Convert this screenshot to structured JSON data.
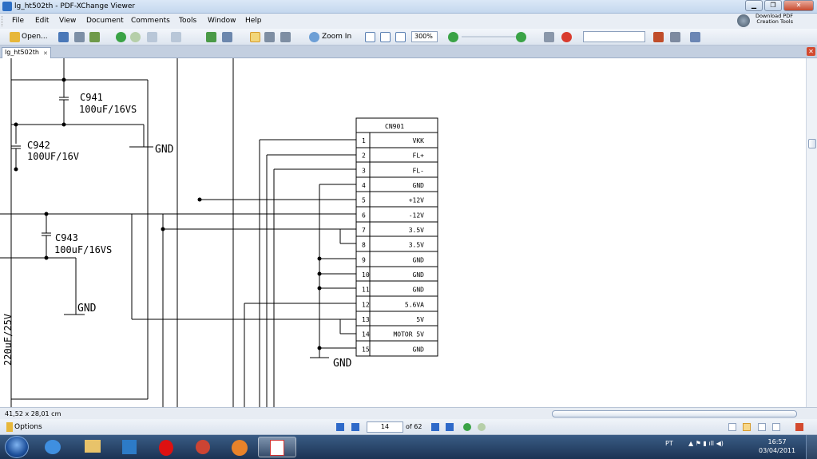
{
  "window": {
    "title": "lg_ht502th - PDF-XChange Viewer"
  },
  "menu": [
    "File",
    "Edit",
    "View",
    "Document",
    "Comments",
    "Tools",
    "Window",
    "Help"
  ],
  "download_promo": {
    "line1": "Download PDF",
    "line2": "Creation Tools"
  },
  "toolbar": {
    "open_label": "Open...",
    "zoom_in_label": "Zoom In",
    "zoom_value": "300%"
  },
  "tab": {
    "label": "lg_ht502th"
  },
  "schematic": {
    "c941": {
      "ref": "C941",
      "value": "100uF/16VS"
    },
    "c942": {
      "ref": "C942",
      "value": "100UF/16V"
    },
    "c943": {
      "ref": "C943",
      "value": "100uF/16VS"
    },
    "vertical_value": "220uF/25V",
    "gnd_label": "GND",
    "connector": {
      "title": "CN901",
      "pins": [
        {
          "num": "1",
          "name": "VKK"
        },
        {
          "num": "2",
          "name": "FL+"
        },
        {
          "num": "3",
          "name": "FL-"
        },
        {
          "num": "4",
          "name": "GND"
        },
        {
          "num": "5",
          "name": "+12V"
        },
        {
          "num": "6",
          "name": "-12V"
        },
        {
          "num": "7",
          "name": "3.5V"
        },
        {
          "num": "8",
          "name": "3.5V"
        },
        {
          "num": "9",
          "name": "GND"
        },
        {
          "num": "10",
          "name": "GND"
        },
        {
          "num": "11",
          "name": "GND"
        },
        {
          "num": "12",
          "name": "5.6VA"
        },
        {
          "num": "13",
          "name": "5V"
        },
        {
          "num": "14",
          "name": "MOTOR 5V"
        },
        {
          "num": "15",
          "name": "GND"
        }
      ]
    }
  },
  "status": {
    "page_dimensions": "41,52 x 28,01 cm"
  },
  "navigation": {
    "options_label": "Options",
    "current_page": "14",
    "total_pages": "of 62"
  },
  "taskbar": {
    "lang": "PT",
    "time": "16:57",
    "date": "03/04/2011"
  }
}
